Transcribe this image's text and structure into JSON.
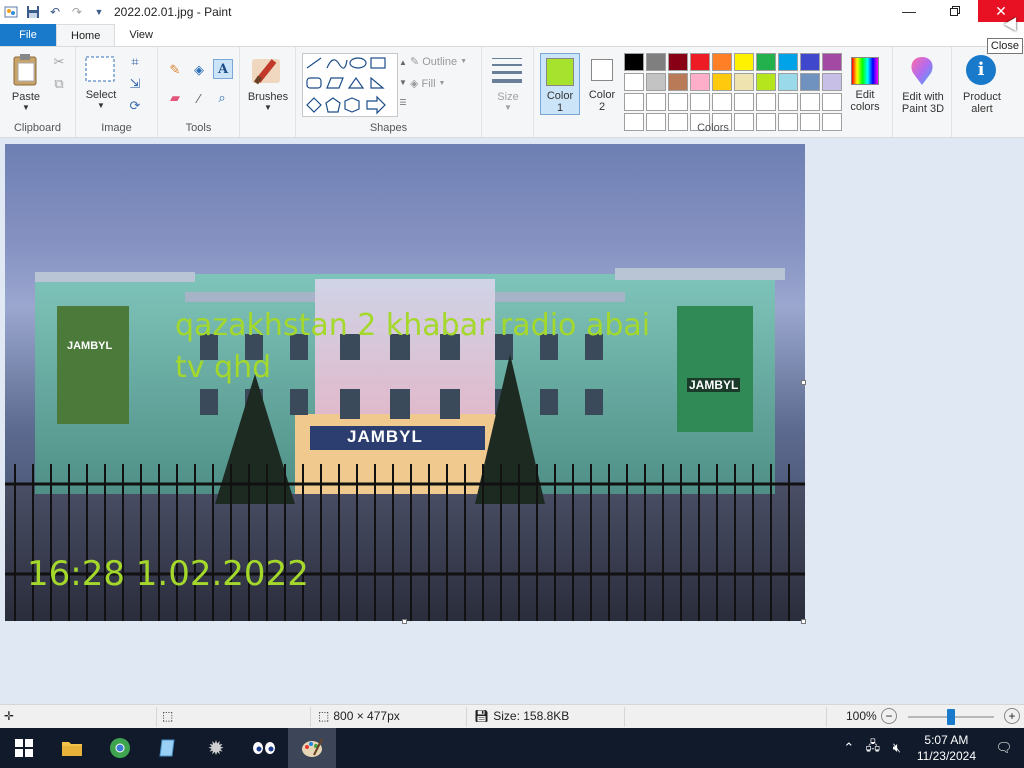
{
  "window": {
    "title": "2022.02.01.jpg - Paint",
    "close_tooltip": "Close"
  },
  "tabs": [
    {
      "label": "File"
    },
    {
      "label": "Home"
    },
    {
      "label": "View"
    }
  ],
  "ribbon": {
    "clipboard": {
      "paste_label": "Paste",
      "group_label": "Clipboard"
    },
    "image": {
      "select_label": "Select",
      "group_label": "Image"
    },
    "tools": {
      "group_label": "Tools"
    },
    "brushes": {
      "label": "Brushes"
    },
    "shapes": {
      "outline_label": "Outline",
      "fill_label": "Fill",
      "group_label": "Shapes"
    },
    "size": {
      "label": "Size"
    },
    "colors": {
      "color1_label": "Color\n1",
      "color1_line1": "Color",
      "color1_line2": "1",
      "color2_line1": "Color",
      "color2_line2": "2",
      "color1_value": "#a6e22e",
      "color2_value": "#ffffff",
      "edit_colors_line1": "Edit",
      "edit_colors_line2": "colors",
      "group_label": "Colors",
      "palette_row1": [
        "#000000",
        "#7f7f7f",
        "#880015",
        "#ed1c24",
        "#ff7f27",
        "#fff200",
        "#22b14c",
        "#00a2e8",
        "#3f48cc",
        "#a349a4"
      ],
      "palette_row2": [
        "#ffffff",
        "#c3c3c3",
        "#b97a57",
        "#ffaec9",
        "#ffc90e",
        "#efe4b0",
        "#b5e61d",
        "#99d9ea",
        "#7092be",
        "#c8bfe7"
      ]
    },
    "edit_paint3d": {
      "line1": "Edit with",
      "line2": "Paint 3D"
    },
    "product_alert": {
      "line1": "Product",
      "line2": "alert"
    }
  },
  "canvas_image": {
    "overlay_text_line1": "qazakhstan 2 khabar radio abai",
    "overlay_text_line2": "tv qhd",
    "timestamp_text": "16:28 1.02.2022",
    "sign_text": "JAMBYL",
    "banner_left_text": "JAMBYL",
    "banner_right_text": "JAMBYL"
  },
  "statusbar": {
    "dimensions": "800 × 477px",
    "size": "Size: 158.8KB",
    "zoom": "100%",
    "zoom_level": 1.0
  },
  "taskbar": {
    "time": "5:07 AM",
    "date": "11/23/2024"
  }
}
